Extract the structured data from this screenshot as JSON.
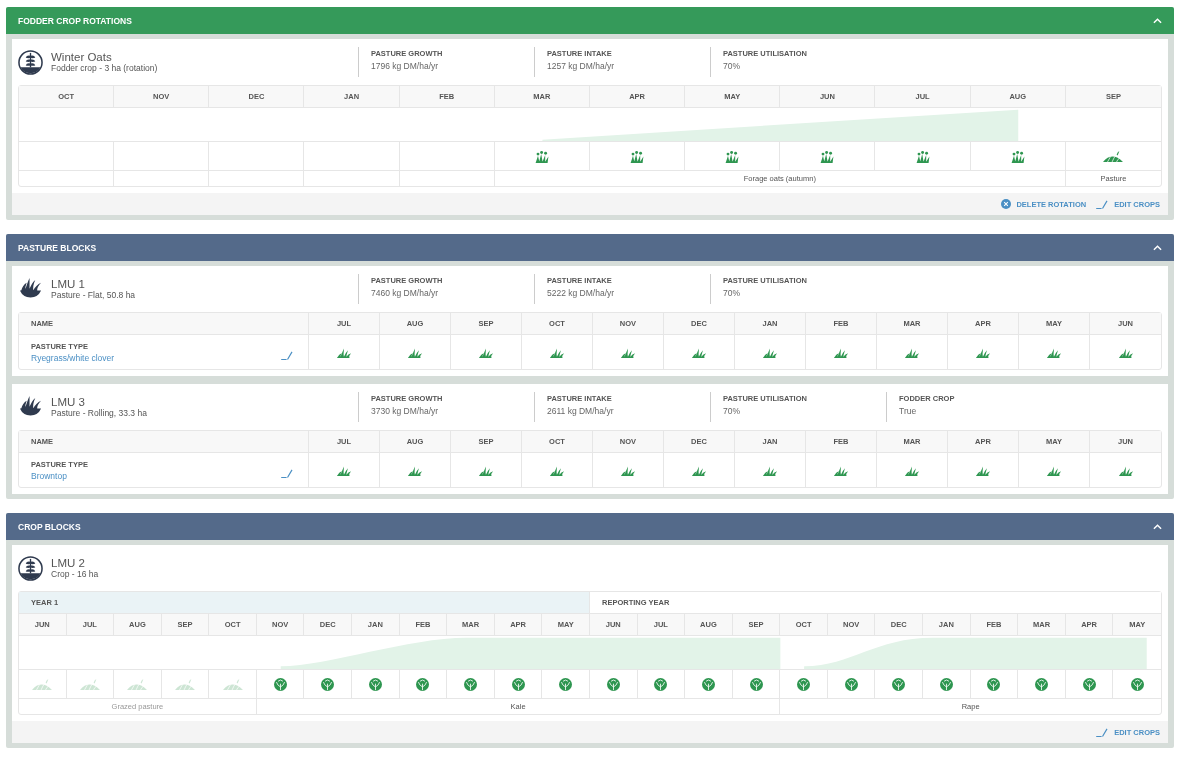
{
  "sections": [
    {
      "title": "FODDER CROP ROTATIONS",
      "color": "#359a5a",
      "expanded": true,
      "blocks": [
        {
          "kind": "rotation",
          "name": "Winter Oats",
          "subtitle": "Fodder crop - 3 ha (rotation)",
          "stats": [
            {
              "label": "PASTURE GROWTH",
              "value": "1796 kg DM/ha/yr"
            },
            {
              "label": "PASTURE INTAKE",
              "value": "1257 kg DM/ha/yr"
            },
            {
              "label": "PASTURE UTILISATION",
              "value": "70%"
            }
          ],
          "segments": [
            {
              "kind": "empty",
              "months": [
                {
                  "label": "OCT"
                },
                {
                  "label": "NOV"
                },
                {
                  "label": "DEC"
                },
                {
                  "label": "JAN"
                },
                {
                  "label": "FEB"
                }
              ]
            },
            {
              "kind": "crop",
              "name": "Forage oats (autumn)",
              "months": [
                {
                  "label": "MAR"
                },
                {
                  "label": "APR"
                },
                {
                  "label": "MAY"
                },
                {
                  "label": "JUN"
                },
                {
                  "label": "JUL"
                },
                {
                  "label": "AUG"
                }
              ]
            },
            {
              "kind": "pasture",
              "name": "Pasture",
              "months": [
                {
                  "label": "SEP"
                }
              ]
            }
          ],
          "actions": [
            {
              "kind": "delete",
              "label": "DELETE ROTATION"
            },
            {
              "kind": "edit",
              "label": "EDIT CROPS"
            }
          ]
        }
      ]
    },
    {
      "title": "PASTURE BLOCKS",
      "color": "#546a8a",
      "expanded": true,
      "blocks": [
        {
          "kind": "pasture",
          "name": "LMU 1",
          "subtitle": "Pasture - Flat, 50.8 ha",
          "stats": [
            {
              "label": "PASTURE GROWTH",
              "value": "7460 kg DM/ha/yr"
            },
            {
              "label": "PASTURE INTAKE",
              "value": "5222 kg DM/ha/yr"
            },
            {
              "label": "PASTURE UTILISATION",
              "value": "70%"
            }
          ],
          "name_header": "NAME",
          "field_label": "PASTURE TYPE",
          "field_value": "Ryegrass/white clover",
          "months": [
            "JUL",
            "AUG",
            "SEP",
            "OCT",
            "NOV",
            "DEC",
            "JAN",
            "FEB",
            "MAR",
            "APR",
            "MAY",
            "JUN"
          ]
        },
        {
          "kind": "pasture",
          "name": "LMU 3",
          "subtitle": "Pasture - Rolling, 33.3 ha",
          "stats": [
            {
              "label": "PASTURE GROWTH",
              "value": "3730 kg DM/ha/yr"
            },
            {
              "label": "PASTURE INTAKE",
              "value": "2611 kg DM/ha/yr"
            },
            {
              "label": "PASTURE UTILISATION",
              "value": "70%"
            },
            {
              "label": "FODDER CROP",
              "value": "True"
            }
          ],
          "name_header": "NAME",
          "field_label": "PASTURE TYPE",
          "field_value": "Browntop",
          "months": [
            "JUL",
            "AUG",
            "SEP",
            "OCT",
            "NOV",
            "DEC",
            "JAN",
            "FEB",
            "MAR",
            "APR",
            "MAY",
            "JUN"
          ]
        }
      ]
    },
    {
      "title": "CROP BLOCKS",
      "color": "#546a8a",
      "expanded": true,
      "blocks": [
        {
          "kind": "crop",
          "name": "LMU 2",
          "subtitle": "Crop - 16 ha",
          "years": [
            {
              "label": "YEAR 1",
              "selected": true
            },
            {
              "label": "REPORTING YEAR",
              "selected": false
            }
          ],
          "segments": [
            {
              "kind": "grazed",
              "name": "Grazed pasture",
              "months": [
                {
                  "label": "JUN"
                },
                {
                  "label": "JUL"
                },
                {
                  "label": "AUG"
                },
                {
                  "label": "SEP"
                },
                {
                  "label": "OCT"
                }
              ]
            },
            {
              "kind": "crop",
              "name": "Kale",
              "months": [
                {
                  "label": "NOV"
                },
                {
                  "label": "DEC"
                },
                {
                  "label": "JAN"
                },
                {
                  "label": "FEB"
                },
                {
                  "label": "MAR"
                },
                {
                  "label": "APR"
                },
                {
                  "label": "MAY"
                },
                {
                  "label": "JUN"
                },
                {
                  "label": "JUL"
                },
                {
                  "label": "AUG"
                },
                {
                  "label": "SEP"
                }
              ]
            },
            {
              "kind": "crop",
              "name": "Rape",
              "months": [
                {
                  "label": "OCT"
                },
                {
                  "label": "NOV"
                },
                {
                  "label": "DEC"
                },
                {
                  "label": "JAN"
                },
                {
                  "label": "FEB"
                },
                {
                  "label": "MAR"
                },
                {
                  "label": "APR"
                },
                {
                  "label": "MAY"
                }
              ]
            }
          ],
          "actions": [
            {
              "kind": "edit",
              "label": "EDIT CROPS"
            }
          ]
        }
      ]
    }
  ]
}
